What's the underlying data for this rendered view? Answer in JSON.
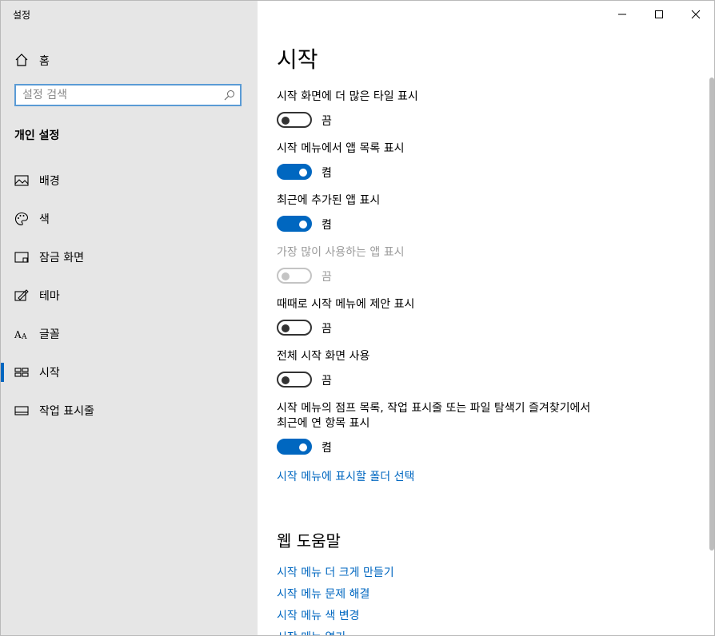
{
  "window": {
    "title": "설정",
    "controls": {
      "minimize": "minimize-icon",
      "maximize": "maximize-icon",
      "close": "close-icon"
    }
  },
  "sidebar": {
    "home_label": "홈",
    "search_placeholder": "설정 검색",
    "section_title": "개인 설정",
    "items": [
      {
        "label": "배경",
        "icon": "picture-icon"
      },
      {
        "label": "색",
        "icon": "palette-icon"
      },
      {
        "label": "잠금 화면",
        "icon": "lock-screen-icon"
      },
      {
        "label": "테마",
        "icon": "theme-icon"
      },
      {
        "label": "글꼴",
        "icon": "font-icon"
      },
      {
        "label": "시작",
        "icon": "start-icon",
        "selected": true
      },
      {
        "label": "작업 표시줄",
        "icon": "taskbar-icon"
      }
    ]
  },
  "main": {
    "title": "시작",
    "settings": [
      {
        "label": "시작 화면에 더 많은 타일 표시",
        "state": "끔",
        "on": false,
        "disabled": false
      },
      {
        "label": "시작 메뉴에서 앱 목록 표시",
        "state": "켬",
        "on": true,
        "disabled": false
      },
      {
        "label": "최근에 추가된 앱 표시",
        "state": "켬",
        "on": true,
        "disabled": false
      },
      {
        "label": "가장 많이 사용하는 앱 표시",
        "state": "끔",
        "on": false,
        "disabled": true
      },
      {
        "label": "때때로 시작 메뉴에 제안 표시",
        "state": "끔",
        "on": false,
        "disabled": false
      },
      {
        "label": "전체 시작 화면 사용",
        "state": "끔",
        "on": false,
        "disabled": false
      },
      {
        "label_line1": "시작 메뉴의 점프 목록, 작업 표시줄 또는 파일 탐색기 즐겨찾기에서",
        "label_line2": "최근에 연 항목 표시",
        "state": "켬",
        "on": true,
        "disabled": false
      }
    ],
    "folder_link": "시작 메뉴에 표시할 폴더 선택",
    "help_title": "웹 도움말",
    "help_links": [
      "시작 메뉴 더 크게 만들기",
      "시작 메뉴 문제 해결",
      "시작 메뉴 색 변경",
      "시작 메뉴 열기"
    ]
  },
  "colors": {
    "accent": "#0067c0",
    "sidebar_bg": "#e6e6e6",
    "disabled": "#9a9a9a"
  }
}
